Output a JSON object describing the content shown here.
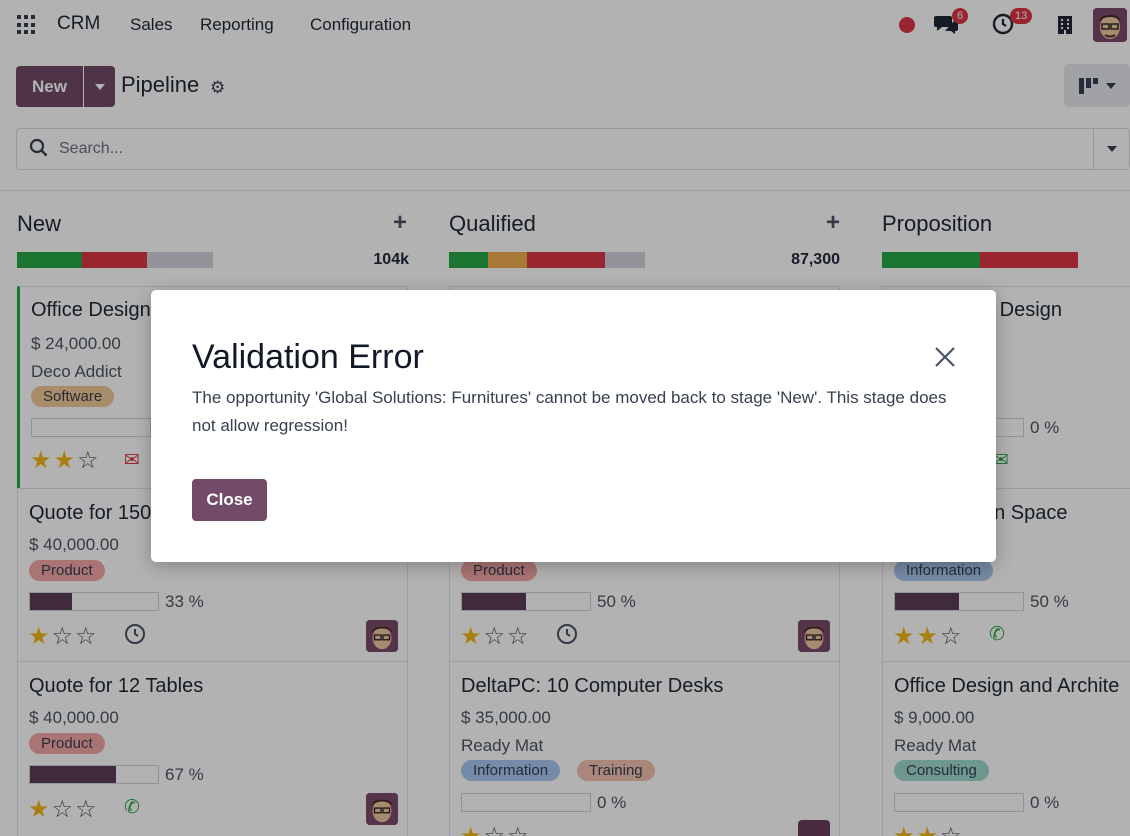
{
  "nav": {
    "brand": "CRM",
    "menu": [
      "Sales",
      "Reporting",
      "Configuration"
    ],
    "chat_count": "6",
    "activity_count": "13"
  },
  "control_panel": {
    "new_label": "New",
    "title": "Pipeline",
    "search_placeholder": "Search..."
  },
  "columns": [
    {
      "title": "New",
      "total": "104k",
      "cards": [
        {
          "title": "Office Design",
          "amount": "$ 24,000.00",
          "partner": "Deco Addict",
          "tags": [
            "Software"
          ],
          "stars": 2
        },
        {
          "title": "Quote for 150",
          "amount": "$ 40,000.00",
          "tags": [
            "Product"
          ],
          "progress": 33,
          "progress_label": "33 %",
          "stars": 1
        },
        {
          "title": "Quote for 12 Tables",
          "amount": "$ 40,000.00",
          "tags": [
            "Product"
          ],
          "progress": 67,
          "progress_label": "67 %",
          "stars": 1
        }
      ]
    },
    {
      "title": "Qualified",
      "total": "87,300",
      "cards": [
        {
          "tags": [
            "Product"
          ],
          "progress": 50,
          "progress_label": "50 %",
          "stars": 1
        },
        {
          "title": "DeltaPC: 10 Computer Desks",
          "amount": "$ 35,000.00",
          "partner": "Ready Mat",
          "tags": [
            "Information",
            "Training"
          ],
          "progress": 0,
          "progress_label": "0 %",
          "stars": 1
        }
      ]
    },
    {
      "title": "Proposition",
      "cards": [
        {
          "title": "e Design",
          "progress_label": "0 %"
        },
        {
          "title": "en Space",
          "tags": [
            "Information"
          ],
          "progress": 50,
          "progress_label": "50 %",
          "stars": 2
        },
        {
          "title": "Office Design and Archite",
          "amount": "$ 9,000.00",
          "partner": "Ready Mat",
          "tags": [
            "Consulting"
          ],
          "progress": 0,
          "progress_label": "0 %",
          "stars": 2
        }
      ]
    }
  ],
  "dialog": {
    "title": "Validation Error",
    "message": "The opportunity 'Global Solutions: Furnitures' cannot be moved back to stage 'New'. This stage does not allow regression!",
    "close_label": "Close"
  },
  "colors": {
    "primary": "#714b67",
    "won": "#28a745",
    "danger": "#dc3545",
    "warning": "#f0ad4e",
    "star": "#f3b817"
  }
}
